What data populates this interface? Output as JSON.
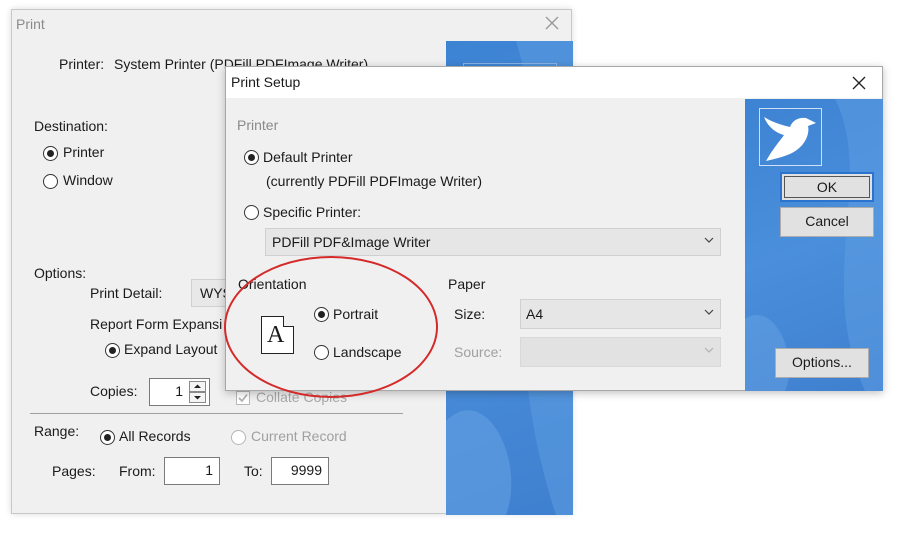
{
  "print_dialog": {
    "title": "Print",
    "printer_label": "Printer:",
    "printer_value": "System Printer (PDFill PDFImage Writer)",
    "destination_label": "Destination:",
    "destination_printer": "Printer",
    "destination_window": "Window",
    "options_label": "Options:",
    "print_detail_label": "Print Detail:",
    "print_detail_value": "WYS",
    "report_form_label": "Report Form Expansi",
    "expand_layout": "Expand Layout",
    "copies_label": "Copies:",
    "copies_value": "1",
    "collate_label": "Collate Copies",
    "range_label": "Range:",
    "all_records": "All Records",
    "current_record": "Current Record",
    "pages_label": "Pages:",
    "from_label": "From:",
    "from_value": "1",
    "to_label": "To:",
    "to_value": "9999"
  },
  "print_setup": {
    "title": "Print Setup",
    "printer_group": "Printer",
    "default_printer": "Default Printer",
    "default_printer_detail": "(currently PDFill PDFImage Writer)",
    "specific_printer": "Specific Printer:",
    "specific_printer_value": "PDFill PDF&Image Writer",
    "orientation_group": "Orientation",
    "portrait_glyph": "A",
    "portrait": "Portrait",
    "landscape": "Landscape",
    "paper_group": "Paper",
    "size_label": "Size:",
    "size_value": "A4",
    "source_label": "Source:",
    "source_value": "",
    "ok_button": "OK",
    "cancel_button": "Cancel",
    "options_button": "Options..."
  },
  "icons": {
    "close": "close-icon",
    "dropdown": "chevron-down-icon",
    "bird": "bird-logo-icon",
    "spin": "spin-arrows-icon"
  },
  "colors": {
    "dialog_bg": "#f0f0f0",
    "blue_panel": "#4a8fdb",
    "annotation_ellipse": "#d42a2a",
    "default_button_border": "#2a74d0"
  },
  "state": {
    "destination_selected": "Printer",
    "setup_printer_selected": "Default Printer",
    "orientation_selected": "Portrait",
    "range_selected": "All Records",
    "collate_checked": true
  }
}
